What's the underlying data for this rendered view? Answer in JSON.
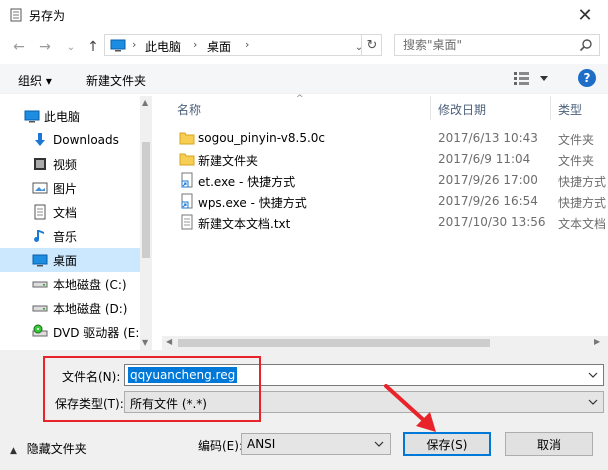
{
  "window": {
    "title": "另存为",
    "close_glyph": "✕"
  },
  "address": {
    "segments": [
      "此电脑",
      "桌面"
    ],
    "separator": "›",
    "search_placeholder": "搜索\"桌面\""
  },
  "toolbar": {
    "organize": "组织 ▾",
    "new_folder": "新建文件夹",
    "help": "?"
  },
  "sidebar": {
    "items": [
      {
        "label": "此电脑",
        "icon": "pc-icon"
      },
      {
        "label": "Downloads",
        "icon": "download-icon"
      },
      {
        "label": "视频",
        "icon": "video-icon"
      },
      {
        "label": "图片",
        "icon": "picture-icon"
      },
      {
        "label": "文档",
        "icon": "document-icon"
      },
      {
        "label": "音乐",
        "icon": "music-icon"
      },
      {
        "label": "桌面",
        "icon": "desktop-icon",
        "selected": true
      },
      {
        "label": "本地磁盘 (C:)",
        "icon": "drive-icon"
      },
      {
        "label": "本地磁盘 (D:)",
        "icon": "drive-icon"
      },
      {
        "label": "DVD 驱动器 (E:)",
        "icon": "dvd-icon"
      }
    ]
  },
  "filelist": {
    "columns": [
      "名称",
      "修改日期",
      "类型"
    ],
    "rows": [
      {
        "name": "sogou_pinyin-v8.5.0c",
        "date": "2017/6/13 10:43",
        "type": "文件夹",
        "icon": "folder-icon"
      },
      {
        "name": "新建文件夹",
        "date": "2017/6/9 11:04",
        "type": "文件夹",
        "icon": "folder-icon"
      },
      {
        "name": "et.exe - 快捷方式",
        "date": "2017/9/26 17:00",
        "type": "快捷方式",
        "icon": "shortcut-icon"
      },
      {
        "name": "wps.exe - 快捷方式",
        "date": "2017/9/26 16:54",
        "type": "快捷方式",
        "icon": "shortcut-icon"
      },
      {
        "name": "新建文本文档.txt",
        "date": "2017/10/30 13:56",
        "type": "文本文档",
        "icon": "text-file-icon"
      }
    ]
  },
  "form": {
    "filename_label": "文件名(N):",
    "filename_value": "qqyuancheng.reg",
    "filetype_label": "保存类型(T):",
    "filetype_value": "所有文件 (*.*)",
    "hide_folders": "隐藏文件夹",
    "encoding_label": "编码(E):",
    "encoding_value": "ANSI",
    "save": "保存(S)",
    "cancel": "取消"
  },
  "colors": {
    "accent": "#0078d7",
    "highlight_box": "#e8242a",
    "arrow": "#e8242a",
    "selection": "#cce8ff"
  }
}
